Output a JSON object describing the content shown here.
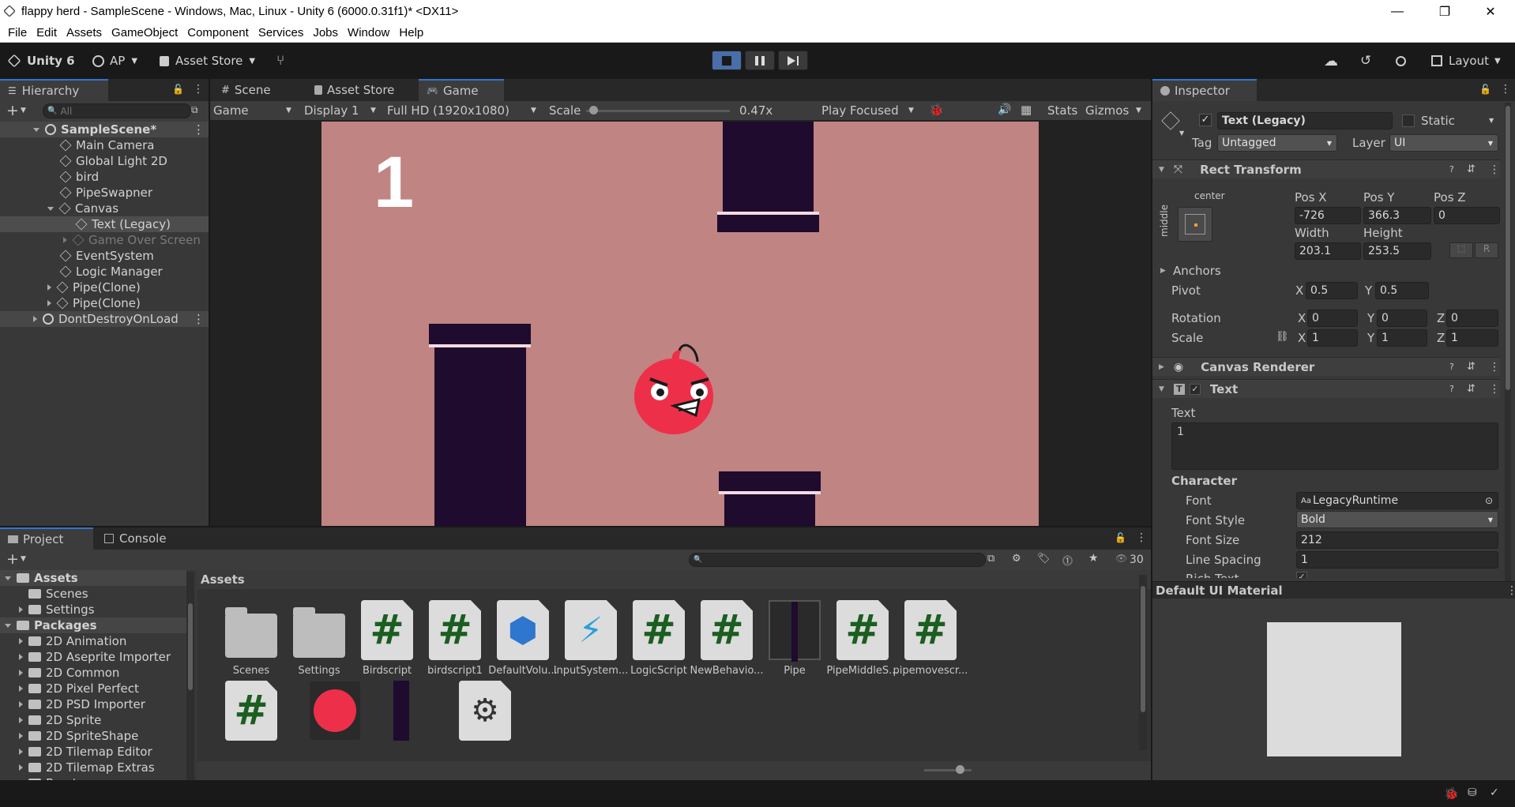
{
  "window": {
    "title": "flappy herd - SampleScene - Windows, Mac, Linux - Unity 6 (6000.0.31f1)* <DX11>",
    "minimize": "—",
    "maximize": "❐",
    "close": "✕"
  },
  "menu": [
    "File",
    "Assets",
    "GameObject",
    "Component",
    "Services",
    "Jobs",
    "Window",
    "Help"
  ],
  "menu_first": "Edit",
  "toolbar": {
    "unity_label": "Unity 6",
    "account": "AP",
    "asset_store": "Asset Store",
    "layout": "Layout"
  },
  "hierarchy": {
    "tab": "Hierarchy",
    "search_placeholder": "All",
    "scene": "SampleScene*",
    "items": [
      {
        "label": "Main Camera"
      },
      {
        "label": "Global Light 2D"
      },
      {
        "label": "bird"
      },
      {
        "label": "PipeSwapner"
      },
      {
        "label": "Canvas"
      },
      {
        "label": "Text (Legacy)"
      },
      {
        "label": "Game Over Screen"
      },
      {
        "label": "EventSystem"
      },
      {
        "label": "Logic Manager"
      },
      {
        "label": "Pipe(Clone)"
      },
      {
        "label": "Pipe(Clone)"
      }
    ],
    "dontdestroy": "DontDestroyOnLoad"
  },
  "center_tabs": {
    "scene": "Scene",
    "asset_store": "Asset Store",
    "game": "Game"
  },
  "game_toolbar": {
    "view": "Game",
    "display": "Display 1",
    "resolution": "Full HD (1920x1080)",
    "scale_label": "Scale",
    "scale_value": "0.47x",
    "scale_fraction": 0.02,
    "play_focused": "Play Focused",
    "stats": "Stats",
    "gizmos": "Gizmos"
  },
  "game": {
    "score": "1",
    "background": "#c08482",
    "pipe_color": "#1e0b2d"
  },
  "inspector": {
    "tab": "Inspector",
    "object_name": "Text (Legacy)",
    "static": "Static",
    "tag_label": "Tag",
    "tag": "Untagged",
    "layer_label": "Layer",
    "layer": "UI",
    "rect_transform": "Rect Transform",
    "anchor_h": "center",
    "anchor_v": "middle",
    "pos_x_label": "Pos X",
    "pos_x": "-726",
    "pos_y_label": "Pos Y",
    "pos_y": "366.3",
    "pos_z_label": "Pos Z",
    "pos_z": "0",
    "width_label": "Width",
    "width": "203.1",
    "height_label": "Height",
    "height": "253.5",
    "r_btn": "R",
    "anchors": "Anchors",
    "pivot": "Pivot",
    "pivot_x": "0.5",
    "pivot_y": "0.5",
    "rotation": "Rotation",
    "rot_x": "0",
    "rot_y": "0",
    "rot_z": "0",
    "scale": "Scale",
    "scale_x": "1",
    "scale_y": "1",
    "scale_z": "1",
    "x": "X",
    "y": "Y",
    "z": "Z",
    "canvas_renderer": "Canvas Renderer",
    "text_comp": "Text",
    "text_label": "Text",
    "text_value": "1",
    "character": "Character",
    "font_label": "Font",
    "font": "LegacyRuntime",
    "font_prefix": "Aa",
    "font_style_label": "Font Style",
    "font_style": "Bold",
    "font_size_label": "Font Size",
    "font_size": "212",
    "line_spacing_label": "Line Spacing",
    "line_spacing": "1",
    "rich_text_label": "Rich Text",
    "material": "Default UI Material"
  },
  "project": {
    "tab": "Project",
    "console_tab": "Console",
    "count": "30",
    "breadcrumb": "Assets",
    "tree": [
      {
        "label": "Assets",
        "level": 0,
        "bold": true
      },
      {
        "label": "Scenes",
        "level": 1
      },
      {
        "label": "Settings",
        "level": 1
      },
      {
        "label": "Packages",
        "level": 0,
        "bold": true
      },
      {
        "label": "2D Animation",
        "level": 1
      },
      {
        "label": "2D Aseprite Importer",
        "level": 1
      },
      {
        "label": "2D Common",
        "level": 1
      },
      {
        "label": "2D Pixel Perfect",
        "level": 1
      },
      {
        "label": "2D PSD Importer",
        "level": 1
      },
      {
        "label": "2D Sprite",
        "level": 1
      },
      {
        "label": "2D SpriteShape",
        "level": 1
      },
      {
        "label": "2D Tilemap Editor",
        "level": 1
      },
      {
        "label": "2D Tilemap Extras",
        "level": 1
      },
      {
        "label": "Burst",
        "level": 1
      }
    ],
    "assets": [
      {
        "label": "Scenes",
        "type": "folder"
      },
      {
        "label": "Settings",
        "type": "folder"
      },
      {
        "label": "Birdscript",
        "type": "script"
      },
      {
        "label": "birdscript1",
        "type": "script"
      },
      {
        "label": "DefaultVolu...",
        "type": "volume"
      },
      {
        "label": "InputSystem...",
        "type": "input"
      },
      {
        "label": "LogicScript",
        "type": "script"
      },
      {
        "label": "NewBehavio...",
        "type": "script"
      },
      {
        "label": "Pipe",
        "type": "prefab"
      },
      {
        "label": "PipeMiddleS...",
        "type": "script"
      },
      {
        "label": "pipemovescr...",
        "type": "script"
      }
    ]
  }
}
